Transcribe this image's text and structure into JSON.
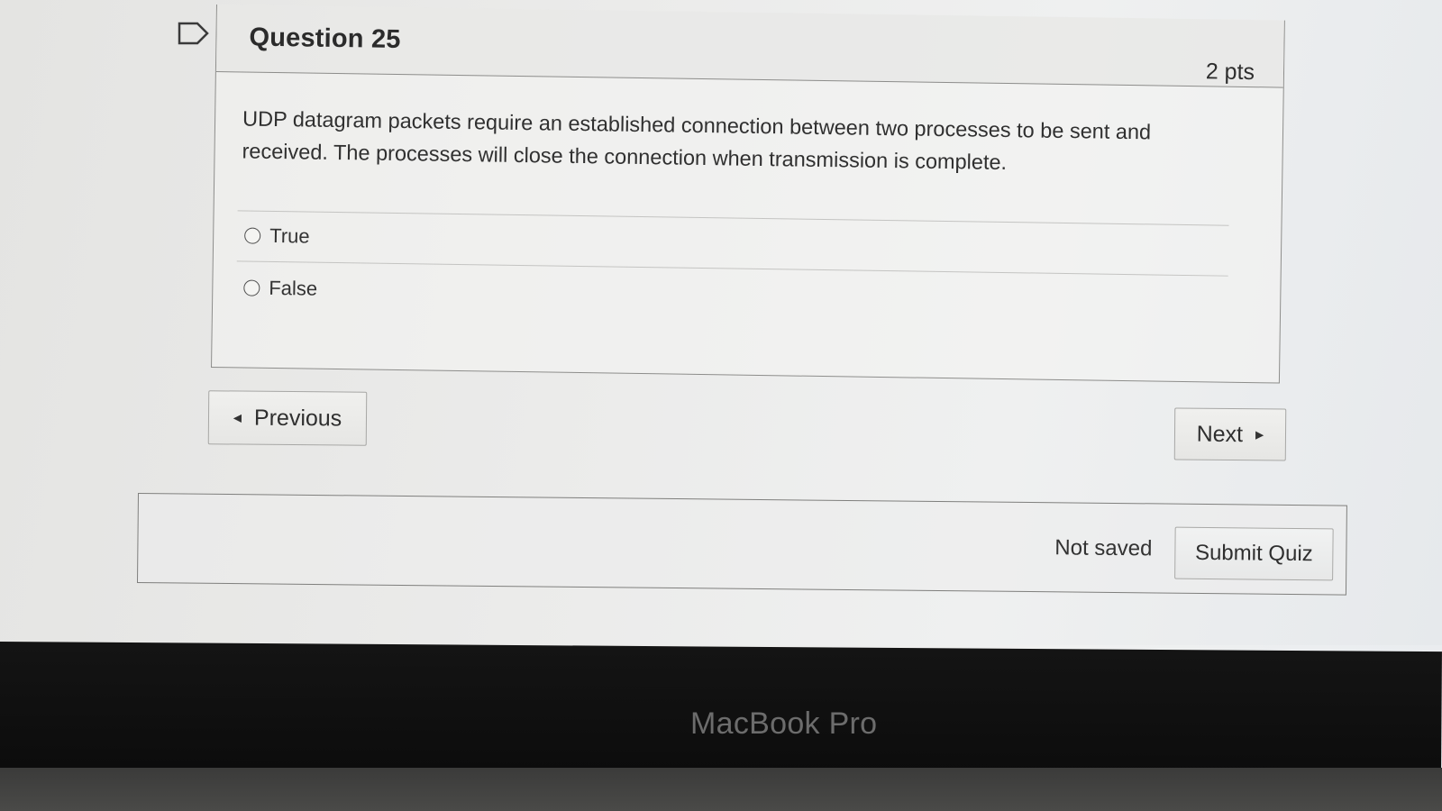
{
  "question": {
    "title": "Question 25",
    "points": "2 pts",
    "text": "UDP datagram packets require an established connection between two processes to be sent and received. The processes will close the connection when transmission is complete.",
    "answers": [
      {
        "label": "True",
        "selected": false
      },
      {
        "label": "False",
        "selected": false
      }
    ]
  },
  "navigation": {
    "previous_label": "Previous",
    "next_label": "Next"
  },
  "footer": {
    "status": "Not saved",
    "submit_label": "Submit Quiz"
  },
  "device": {
    "label": "MacBook Pro"
  },
  "icons": {
    "flag": "flag-icon",
    "previous": "chevron-left-icon",
    "next": "chevron-right-icon"
  }
}
